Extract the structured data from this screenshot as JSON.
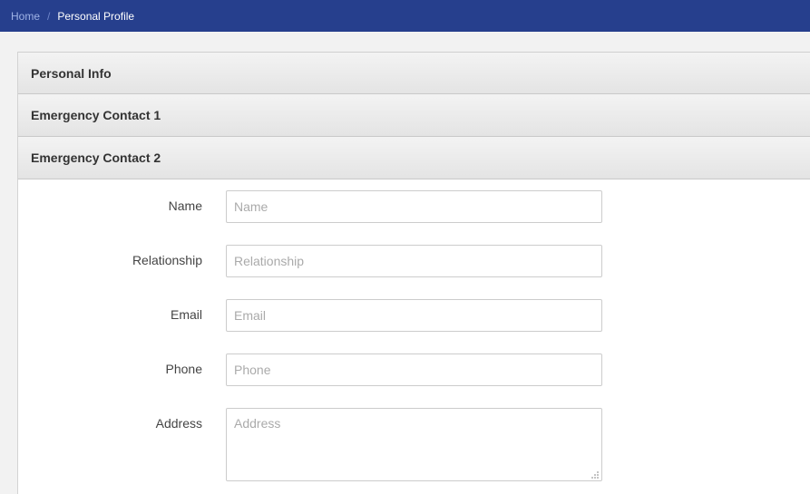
{
  "breadcrumb": {
    "home": "Home",
    "separator": "/",
    "current": "Personal Profile"
  },
  "accordion": {
    "sections": [
      {
        "label": "Personal Info"
      },
      {
        "label": "Emergency Contact 1"
      },
      {
        "label": "Emergency Contact 2"
      }
    ]
  },
  "form": {
    "name": {
      "label": "Name",
      "placeholder": "Name",
      "value": ""
    },
    "relationship": {
      "label": "Relationship",
      "placeholder": "Relationship",
      "value": ""
    },
    "email": {
      "label": "Email",
      "placeholder": "Email",
      "value": ""
    },
    "phone": {
      "label": "Phone",
      "placeholder": "Phone",
      "value": ""
    },
    "address": {
      "label": "Address",
      "placeholder": "Address",
      "value": ""
    }
  },
  "colors": {
    "topbar": "#263f8d",
    "panel_header": "#e8e8e8",
    "background": "#f2f2f2"
  },
  "icons": {
    "resize": "resize-grip-icon"
  }
}
